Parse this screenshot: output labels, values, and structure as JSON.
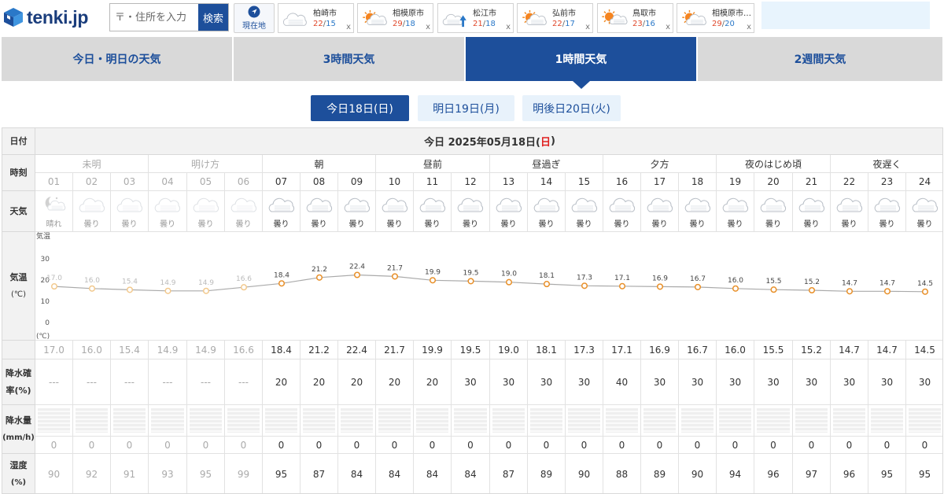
{
  "header": {
    "logo_text": "tenki.jp",
    "search_placeholder": "〒・住所を入力",
    "search_button": "検索",
    "locate_label": "現在地",
    "recent_cities": [
      {
        "name": "柏崎市",
        "high": "22",
        "low": "15",
        "icon": "cloud-icon",
        "close": "x"
      },
      {
        "name": "相模原市",
        "high": "29",
        "low": "18",
        "icon": "sun-cloud-icon",
        "close": "x"
      },
      {
        "name": "松江市",
        "high": "21",
        "low": "18",
        "icon": "cloud-arrow-up-icon",
        "close": "x"
      },
      {
        "name": "弘前市",
        "high": "22",
        "low": "17",
        "icon": "sun-cloud-icon",
        "close": "x"
      },
      {
        "name": "鳥取市",
        "high": "23",
        "low": "16",
        "icon": "sun-arrow-cloud-icon",
        "close": "x"
      },
      {
        "name": "相模原市…",
        "high": "29",
        "low": "20",
        "icon": "sun-cloud-icon",
        "close": "x"
      }
    ],
    "temp_separator": "/"
  },
  "tabs": [
    {
      "label": "今日・明日の天気",
      "active": false
    },
    {
      "label": "3時間天気",
      "active": false
    },
    {
      "label": "1時間天気",
      "active": true
    },
    {
      "label": "2週間天気",
      "active": false
    }
  ],
  "day_buttons": [
    {
      "label": "今日18日(日)",
      "active": true
    },
    {
      "label": "明日19日(月)",
      "active": false
    },
    {
      "label": "明後日20日(火)",
      "active": false
    }
  ],
  "table": {
    "date_label": "日付",
    "date_prefix": "今日 2025年05月18日(",
    "date_weekday": "日",
    "date_suffix": ")",
    "row_labels": {
      "time": "時刻",
      "weather": "天気",
      "temp_line1": "気温",
      "temp_line2": "(℃)",
      "precip_prob_line1": "降水確",
      "precip_prob_line2": "率(%)",
      "precip_amt_line1": "降水量",
      "precip_amt_line2": "(mm/h)",
      "humidity_line1": "湿度",
      "humidity_line2": "(%)"
    },
    "periods": [
      "未明",
      "明け方",
      "朝",
      "昼前",
      "昼過ぎ",
      "夕方",
      "夜のはじめ頃",
      "夜遅く"
    ],
    "hours": [
      "01",
      "02",
      "03",
      "04",
      "05",
      "06",
      "07",
      "08",
      "09",
      "10",
      "11",
      "12",
      "13",
      "14",
      "15",
      "16",
      "17",
      "18",
      "19",
      "20",
      "21",
      "22",
      "23",
      "24"
    ],
    "weather": [
      "晴れ",
      "曇り",
      "曇り",
      "曇り",
      "曇り",
      "曇り",
      "曇り",
      "曇り",
      "曇り",
      "曇り",
      "曇り",
      "曇り",
      "曇り",
      "曇り",
      "曇り",
      "曇り",
      "曇り",
      "曇り",
      "曇り",
      "曇り",
      "曇り",
      "曇り",
      "曇り",
      "曇り"
    ],
    "weather_icons": [
      "moon-cloud-icon",
      "cloud-icon",
      "cloud-icon",
      "cloud-icon",
      "cloud-icon",
      "cloud-icon",
      "cloud-icon",
      "cloud-icon",
      "cloud-icon",
      "cloud-icon",
      "cloud-icon",
      "cloud-icon",
      "cloud-icon",
      "cloud-icon",
      "cloud-icon",
      "cloud-icon",
      "cloud-icon",
      "cloud-icon",
      "cloud-icon",
      "cloud-icon",
      "cloud-icon",
      "cloud-icon",
      "cloud-icon",
      "cloud-icon"
    ],
    "temps_text": [
      "17.0",
      "16.0",
      "15.4",
      "14.9",
      "14.9",
      "16.6",
      "18.4",
      "21.2",
      "22.4",
      "21.7",
      "19.9",
      "19.5",
      "19.0",
      "18.1",
      "17.3",
      "17.1",
      "16.9",
      "16.7",
      "16.0",
      "15.5",
      "15.2",
      "14.7",
      "14.7",
      "14.5"
    ],
    "precip_prob": [
      "---",
      "---",
      "---",
      "---",
      "---",
      "---",
      "20",
      "20",
      "20",
      "20",
      "20",
      "30",
      "30",
      "30",
      "30",
      "40",
      "30",
      "30",
      "30",
      "30",
      "30",
      "30",
      "30",
      "30"
    ],
    "precip_amount": [
      "0",
      "0",
      "0",
      "0",
      "0",
      "0",
      "0",
      "0",
      "0",
      "0",
      "0",
      "0",
      "0",
      "0",
      "0",
      "0",
      "0",
      "0",
      "0",
      "0",
      "0",
      "0",
      "0",
      "0"
    ],
    "humidity": [
      "90",
      "92",
      "91",
      "93",
      "95",
      "99",
      "95",
      "87",
      "84",
      "84",
      "84",
      "84",
      "87",
      "89",
      "90",
      "88",
      "89",
      "90",
      "94",
      "96",
      "97",
      "96",
      "95",
      "95"
    ]
  },
  "chart_data": {
    "type": "line",
    "ylabel": "気温",
    "yunit": "(℃)",
    "ylim": [
      0,
      30
    ],
    "yticks": [
      "30",
      "20",
      "10",
      "0"
    ],
    "x": [
      "01",
      "02",
      "03",
      "04",
      "05",
      "06",
      "07",
      "08",
      "09",
      "10",
      "11",
      "12",
      "13",
      "14",
      "15",
      "16",
      "17",
      "18",
      "19",
      "20",
      "21",
      "22",
      "23",
      "24"
    ],
    "series": [
      {
        "values": [
          17.0,
          16.0,
          15.4,
          14.9,
          14.9,
          16.6,
          18.4,
          21.2,
          22.4,
          21.7,
          19.9,
          19.5,
          19.0,
          18.1,
          17.3,
          17.1,
          16.9,
          16.7,
          16.0,
          15.5,
          15.2,
          14.7,
          14.7,
          14.5
        ]
      }
    ],
    "past_count": 6,
    "colors": {
      "line": "#aaaaaa",
      "marker_edge": "#e8902a",
      "marker_edge_past": "#f2c98e",
      "label_past": "#bbbbbb"
    },
    "grid": false
  },
  "colors": {
    "brand": "#1d4f9b",
    "tab_bg": "#d9d9d9",
    "sunday": "#e02020"
  }
}
